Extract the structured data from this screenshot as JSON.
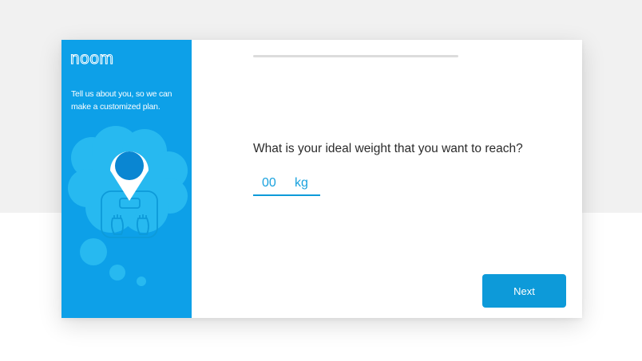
{
  "brand": {
    "logo_text": "noom"
  },
  "sidebar": {
    "tagline": "Tell us about you, so we can make a customized plan.",
    "illustration_icon": "scale-location-pin-icon"
  },
  "progress": {
    "fraction": 0.0
  },
  "question": {
    "text": "What is your ideal weight that you want to reach?"
  },
  "weight_input": {
    "value": "00",
    "unit": "kg"
  },
  "actions": {
    "next_label": "Next"
  },
  "colors": {
    "brand_blue": "#0da0e8",
    "button_blue": "#0d9ad9",
    "cloud_light": "#27b9f0",
    "pin_dark": "#0a86d2",
    "text_dark": "#2b2b2b",
    "page_bg_top": "#f1f1f1"
  }
}
